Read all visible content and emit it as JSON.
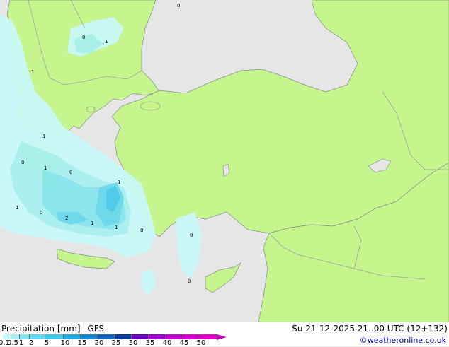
{
  "legend": {
    "title": "Precipitation [mm]",
    "model": "GFS",
    "datetime": "Su 21-12-2025 21..00 UTC (12+132)",
    "credit": "©weatheronline.co.uk",
    "scale_labels": [
      "0.1",
      "0.5",
      "1",
      "2",
      "5",
      "10",
      "15",
      "20",
      "25",
      "30",
      "35",
      "40",
      "45",
      "50"
    ],
    "scale_colors": [
      "#c8fafa",
      "#a6f0f0",
      "#86e6ee",
      "#64d8ec",
      "#46c8ea",
      "#2aa8e0",
      "#1a88d0",
      "#1464b8",
      "#0a3a98",
      "#6a00b8",
      "#9a00c8",
      "#c000d0",
      "#d800d0",
      "#e000c8"
    ]
  },
  "map": {
    "colors": {
      "land": "#c6f58e",
      "sea": "#e6e6e6",
      "border": "#9aa0a0",
      "coast": "#808a8a"
    },
    "point_labels": [
      "0",
      "0",
      "1",
      "1",
      "0",
      "1",
      "0",
      "1",
      "0",
      "2",
      "1",
      "1",
      "1",
      "0",
      "0",
      "0",
      "1"
    ]
  }
}
